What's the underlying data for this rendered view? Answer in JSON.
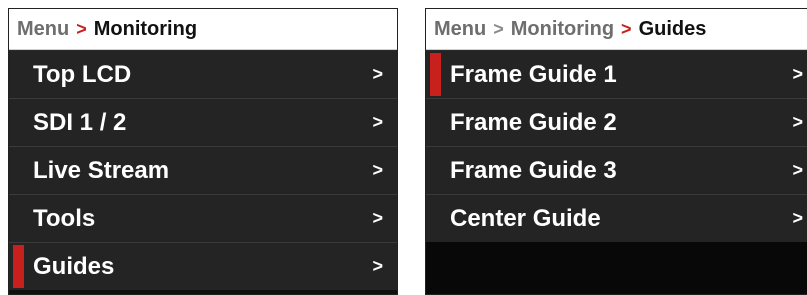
{
  "left_panel": {
    "breadcrumb": {
      "parent": "Menu",
      "separator": ">",
      "current": "Monitoring"
    },
    "items": [
      {
        "label": "Top LCD",
        "chevron": ">",
        "active": false
      },
      {
        "label": "SDI 1 / 2",
        "chevron": ">",
        "active": false
      },
      {
        "label": "Live Stream",
        "chevron": ">",
        "active": false
      },
      {
        "label": "Tools",
        "chevron": ">",
        "active": false
      },
      {
        "label": "Guides",
        "chevron": ">",
        "active": true
      }
    ]
  },
  "right_panel": {
    "breadcrumb": {
      "parent": "Menu",
      "separator_1": ">",
      "middle": "Monitoring",
      "separator_2": ">",
      "current": "Guides"
    },
    "items": [
      {
        "label": "Frame Guide 1",
        "chevron": ">",
        "active": true
      },
      {
        "label": "Frame Guide 2",
        "chevron": ">",
        "active": false
      },
      {
        "label": "Frame Guide 3",
        "chevron": ">",
        "active": false
      },
      {
        "label": "Center Guide",
        "chevron": ">",
        "active": false
      }
    ]
  },
  "colors": {
    "accent": "#c8201d",
    "item_background": "#242424",
    "breadcrumb_background": "#ffffff"
  }
}
